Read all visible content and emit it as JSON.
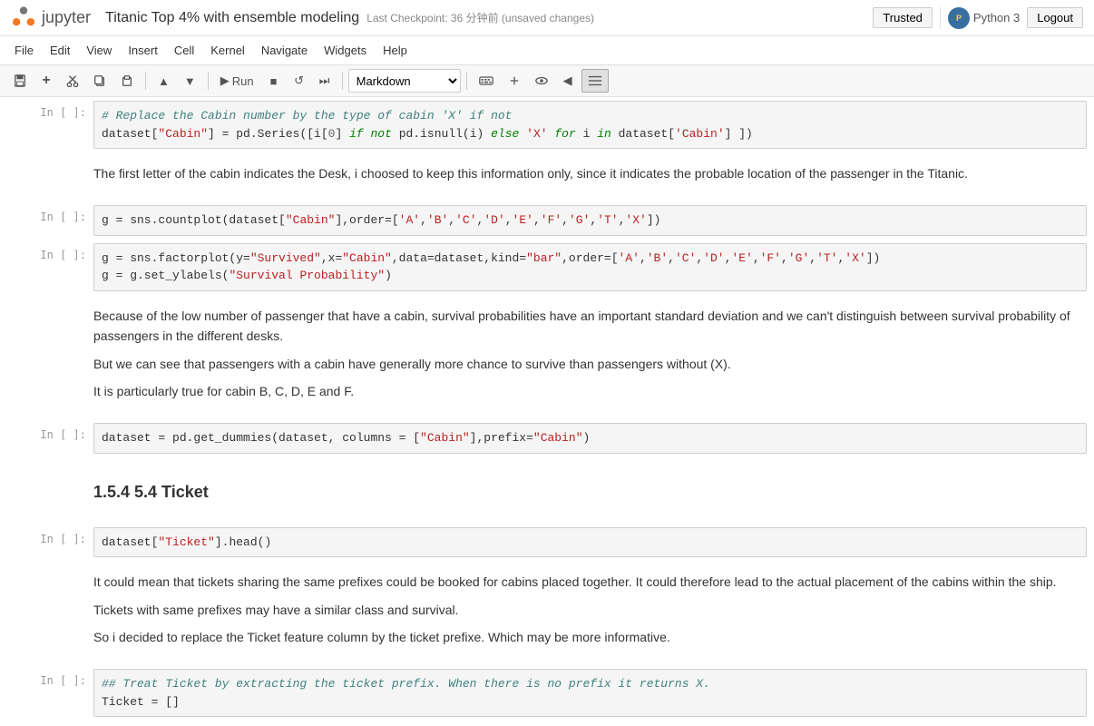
{
  "topbar": {
    "logo_text": "jupyter",
    "title": "Titanic Top 4% with ensemble modeling",
    "checkpoint": "Last Checkpoint: 36 分钟前  (unsaved changes)",
    "trusted_label": "Trusted",
    "python_label": "Python 3",
    "logout_label": "Logout"
  },
  "menubar": {
    "items": [
      "File",
      "Edit",
      "View",
      "Insert",
      "Cell",
      "Kernel",
      "Navigate",
      "Widgets",
      "Help"
    ]
  },
  "toolbar": {
    "save_label": "💾",
    "add_label": "+",
    "cut_label": "✂",
    "copy_label": "⎘",
    "paste_label": "⎗",
    "move_up_label": "▲",
    "move_down_label": "▼",
    "run_label": "▶ Run",
    "stop_label": "■",
    "restart_label": "↺",
    "fast_forward_label": "⏭",
    "cell_type": "Markdown",
    "keyboard_label": "⌨",
    "extend_label": "⤢",
    "eye_label": "👁",
    "left_label": "◀",
    "list_label": "≡"
  },
  "cells": [
    {
      "type": "code",
      "prompt": "In [ ]:",
      "lines": [
        "# Replace the Cabin number by the type of cabin 'X' if not",
        "dataset[\"Cabin\"] = pd.Series([i[0] if not pd.isnull(i) else 'X' for i in dataset['Cabin'] ])"
      ]
    },
    {
      "type": "markdown",
      "content": "The first letter of the cabin indicates the Desk, i choosed to keep this information only, since it indicates the probable location of the passenger in the Titanic."
    },
    {
      "type": "code",
      "prompt": "In [ ]:",
      "lines": [
        "g = sns.countplot(dataset[\"Cabin\"],order=['A','B','C','D','E','F','G','T','X'])"
      ]
    },
    {
      "type": "code",
      "prompt": "In [ ]:",
      "lines": [
        "g = sns.factorplot(y=\"Survived\",x=\"Cabin\",data=dataset,kind=\"bar\",order=['A','B','C','D','E','F','G','T','X'])",
        "g = g.set_ylabels(\"Survival Probability\")"
      ]
    },
    {
      "type": "markdown",
      "content_lines": [
        "Because of the low number of passenger that have a cabin, survival probabilities have an important standard deviation and we can't distinguish between survival probability of passengers in the different desks.",
        "But we can see that passengers with a cabin have generally more chance to survive than passengers without (X).",
        "It is particularly true for cabin B, C, D, E and F."
      ]
    },
    {
      "type": "code",
      "prompt": "In [ ]:",
      "lines": [
        "dataset = pd.get_dummies(dataset, columns = [\"Cabin\"],prefix=\"Cabin\")"
      ]
    },
    {
      "type": "markdown",
      "heading": "1.5.4  5.4 Ticket"
    },
    {
      "type": "code",
      "prompt": "In [ ]:",
      "lines": [
        "dataset[\"Ticket\"].head()"
      ]
    },
    {
      "type": "markdown",
      "content_lines": [
        "It could mean that tickets sharing the same prefixes could be booked for cabins placed together. It could therefore lead to the actual placement of the cabins within the ship.",
        "Tickets with same prefixes may have a similar class and survival.",
        "So i decided to replace the Ticket feature column by the ticket prefixe. Which may be more informative."
      ]
    },
    {
      "type": "code",
      "prompt": "In [ ]:",
      "lines": [
        "## Treat Ticket by extracting the ticket prefix. When there is no prefix it returns X.",
        "Ticket = []"
      ]
    }
  ]
}
